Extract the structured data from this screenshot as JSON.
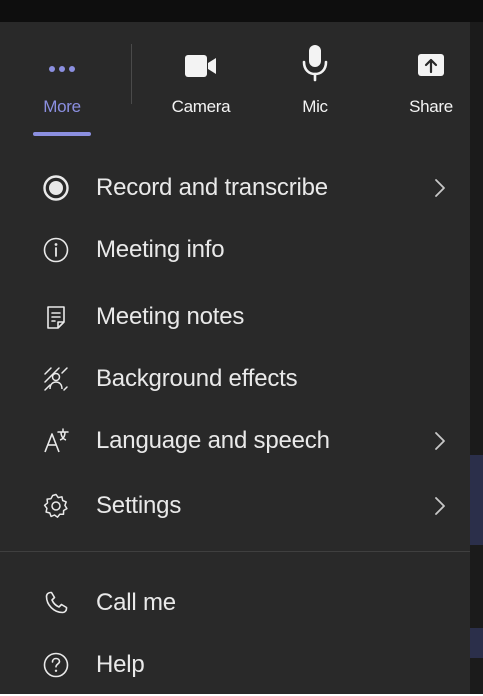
{
  "toolbar": {
    "items": [
      {
        "label": "More",
        "icon": "more-dots-icon",
        "active": true
      },
      {
        "label": "Camera",
        "icon": "camera-icon"
      },
      {
        "label": "Mic",
        "icon": "microphone-icon"
      },
      {
        "label": "Share",
        "icon": "share-icon"
      }
    ],
    "accent_color": "#8b8fe0"
  },
  "menu": {
    "items": [
      {
        "label": "Record and transcribe",
        "icon": "record-icon",
        "has_submenu": true
      },
      {
        "label": "Meeting info",
        "icon": "info-icon",
        "has_submenu": false
      },
      {
        "label": "Meeting notes",
        "icon": "notes-icon",
        "has_submenu": false
      },
      {
        "label": "Background effects",
        "icon": "background-effects-icon",
        "has_submenu": false
      },
      {
        "label": "Language and speech",
        "icon": "language-icon",
        "has_submenu": true
      },
      {
        "label": "Settings",
        "icon": "gear-icon",
        "has_submenu": true
      }
    ],
    "footer_items": [
      {
        "label": "Call me",
        "icon": "phone-icon"
      },
      {
        "label": "Help",
        "icon": "help-icon"
      }
    ]
  },
  "colors": {
    "panel_background": "#292929",
    "text": "#e9e9e9"
  }
}
